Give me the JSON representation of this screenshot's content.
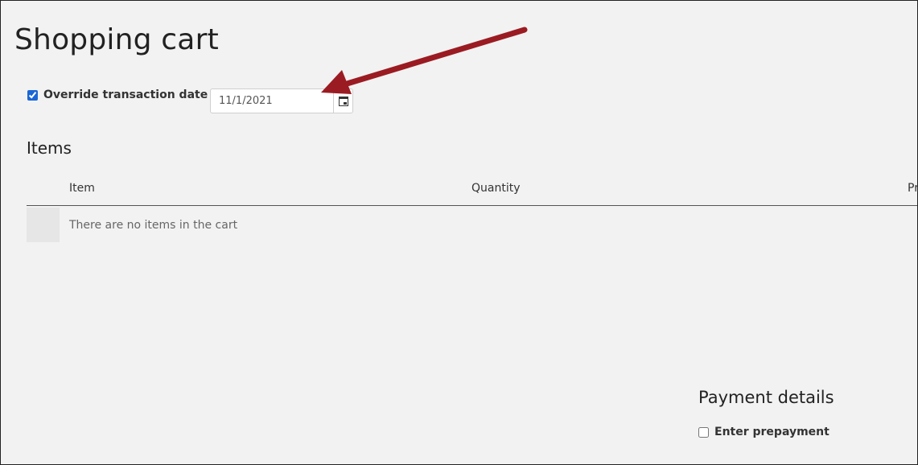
{
  "page": {
    "title": "Shopping cart"
  },
  "override": {
    "checked": true,
    "label": "Override transaction date",
    "date_value": "11/1/2021"
  },
  "items": {
    "heading": "Items",
    "columns": [
      "Item",
      "Quantity",
      "Pr"
    ],
    "empty_message": "There are no items in the cart"
  },
  "payment": {
    "heading": "Payment details",
    "prepay_checked": false,
    "prepay_label": "Enter prepayment"
  },
  "icons": {
    "date_picker": "calendar-icon",
    "annotation": "arrow-icon"
  },
  "colors": {
    "background": "#f2f2f2",
    "arrow": "#9b1b22",
    "accent": "#1a66d6"
  }
}
